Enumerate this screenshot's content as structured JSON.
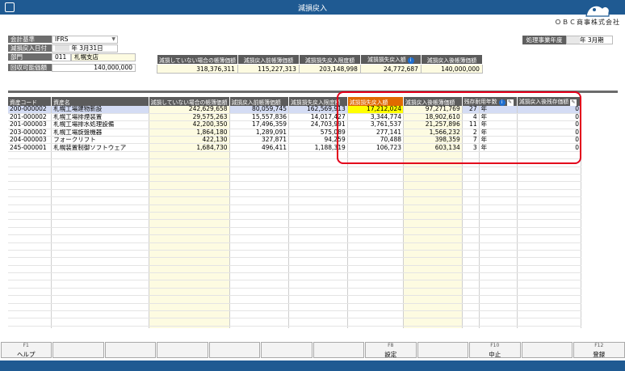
{
  "window": {
    "title": "減損戻入"
  },
  "company": {
    "name": "ＯＢＣ商事株式会社"
  },
  "filters": {
    "accounting_standard": {
      "label": "会計基準",
      "value": "IFRS"
    },
    "reversal_date": {
      "label": "減損戻入日付",
      "value": "年  3月31日"
    },
    "department": {
      "label": "部門",
      "code": "011",
      "name": "札幌支店"
    },
    "recoverable_amount": {
      "label": "回収可能価額",
      "value": "140,000,000"
    }
  },
  "fiscal_year": {
    "label": "処理事業年度",
    "value": "年  3月期"
  },
  "summary": {
    "headers": [
      "減損していない場合の帳簿価額",
      "減損戻入前帳簿価額",
      "減損損失戻入限度額",
      "減損損失戻入額",
      "減損戻入後帳簿価額"
    ],
    "values": [
      "318,376,311",
      "115,227,313",
      "203,148,998",
      "24,772,687",
      "140,000,000"
    ]
  },
  "grid": {
    "headers": [
      "資産コード",
      "資産名",
      "減損していない場合の帳簿価額",
      "減損戻入前帳簿価額",
      "減損損失戻入限度額",
      "減損損失戻入額",
      "減損戻入後帳簿価額",
      "残存耐用年数",
      "減損戻入後残存価額"
    ],
    "rows": [
      {
        "code": "200-000002",
        "name": "札幌工場建物新設",
        "c1": "242,629,658",
        "c2": "80,059,745",
        "c3": "162,569,913",
        "c4": "17,212,024",
        "c5": "97,271,769",
        "years": "27",
        "unit": "年",
        "c6": "0"
      },
      {
        "code": "201-000002",
        "name": "札幌工場排煙装置",
        "c1": "29,575,263",
        "c2": "15,557,836",
        "c3": "14,017,427",
        "c4": "3,344,774",
        "c5": "18,902,610",
        "years": "4",
        "unit": "年",
        "c6": "0"
      },
      {
        "code": "201-000003",
        "name": "札幌工場排水処理設備",
        "c1": "42,200,350",
        "c2": "17,496,359",
        "c3": "24,703,991",
        "c4": "3,761,537",
        "c5": "21,257,896",
        "years": "11",
        "unit": "年",
        "c6": "0"
      },
      {
        "code": "203-000002",
        "name": "札幌工場旋盤機器",
        "c1": "1,864,180",
        "c2": "1,289,091",
        "c3": "575,089",
        "c4": "277,141",
        "c5": "1,566,232",
        "years": "2",
        "unit": "年",
        "c6": "0"
      },
      {
        "code": "204-000003",
        "name": "フォークリフト",
        "c1": "422,130",
        "c2": "327,871",
        "c3": "94,259",
        "c4": "70,488",
        "c5": "398,359",
        "years": "7",
        "unit": "年",
        "c6": "0"
      },
      {
        "code": "245-000001",
        "name": "札幌装置制御ソフトウェア",
        "c1": "1,684,730",
        "c2": "496,411",
        "c3": "1,188,319",
        "c4": "106,723",
        "c5": "603,134",
        "years": "3",
        "unit": "年",
        "c6": "0"
      }
    ]
  },
  "fkeys": [
    {
      "key": "F1",
      "label": "ヘルプ"
    },
    {
      "key": "",
      "label": ""
    },
    {
      "key": "",
      "label": ""
    },
    {
      "key": "",
      "label": ""
    },
    {
      "key": "",
      "label": ""
    },
    {
      "key": "",
      "label": ""
    },
    {
      "key": "",
      "label": ""
    },
    {
      "key": "F8",
      "label": "設定"
    },
    {
      "key": "",
      "label": ""
    },
    {
      "key": "F10",
      "label": "中止"
    },
    {
      "key": "",
      "label": ""
    },
    {
      "key": "F12",
      "label": "登録"
    }
  ],
  "colors": {
    "title_bar": "#1f5a92",
    "header": "#5b5b5b",
    "highlight_header": "#e06a00",
    "yellow_cell": "#ffff00",
    "selected_row": "#d4dcf4",
    "red_box": "#e3001b"
  }
}
